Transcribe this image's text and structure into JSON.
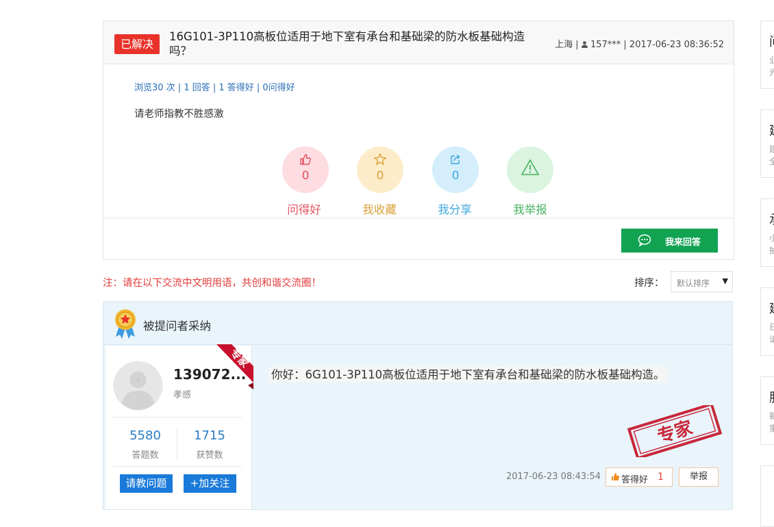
{
  "question": {
    "status": "已解决",
    "title": "16G101-3P110高板位适用于地下室有承台和基础梁的防水板基础构造吗？",
    "location": "上海",
    "asker": "157***",
    "datetime": "2017-06-23 08:36:52",
    "stats": "浏览30 次 | 1 回答 | 1 答得好 | 0问得好",
    "body": "请老师指教不胜感激",
    "actions": [
      {
        "label": "问得好",
        "count": "0",
        "color": "#e3525f",
        "bg": "#fddde2",
        "icon": "thumbs-up-icon"
      },
      {
        "label": "我收藏",
        "count": "0",
        "color": "#d9a23a",
        "bg": "#fdecc9",
        "icon": "star-icon"
      },
      {
        "label": "我分享",
        "count": "0",
        "color": "#3ea6dd",
        "bg": "#d4eefb",
        "icon": "share-icon"
      },
      {
        "label": "我举报",
        "count": "",
        "color": "#45b05f",
        "bg": "#daf4df",
        "icon": "warning-icon"
      }
    ],
    "answer_button": "我来回答"
  },
  "notice": "注：请在以下交流中文明用语，共创和谐交流圈！",
  "sort": {
    "label": "排序：",
    "value": "默认排序"
  },
  "adopted": {
    "header": "被提问者采纳",
    "user": {
      "name": "139072...",
      "city": "孝感",
      "badge": "专家",
      "answers": "5580",
      "answers_label": "答题数",
      "likes": "1715",
      "likes_label": "获赞数",
      "ask_button": "请教问题",
      "follow_button": "+加关注"
    },
    "answer_text": "你好：6G101-3P110高板位适用于地下室有承台和基础梁的防水板基础构造。",
    "stamp": "专家",
    "datetime": "2017-06-23 08:43:54",
    "like_label": "答得好",
    "like_count": "1",
    "report_label": "举报"
  },
  "sidebar": [
    {
      "t": "问",
      "s1": "业",
      "s2": "光"
    },
    {
      "t": "建",
      "s1": "建",
      "s2": "全"
    },
    {
      "t": "承",
      "s1": "小",
      "s2": "抽"
    },
    {
      "t": "建",
      "s1": "日",
      "s2": "请"
    },
    {
      "t": "服",
      "s1": "新",
      "s2": "家"
    },
    {
      "t": "",
      "s1": "",
      "s2": ""
    }
  ],
  "colors": {
    "accent_green": "#12a352",
    "solved_red": "#e8322a",
    "link_blue": "#2a6db5",
    "btn_blue": "#1a7ad9"
  }
}
